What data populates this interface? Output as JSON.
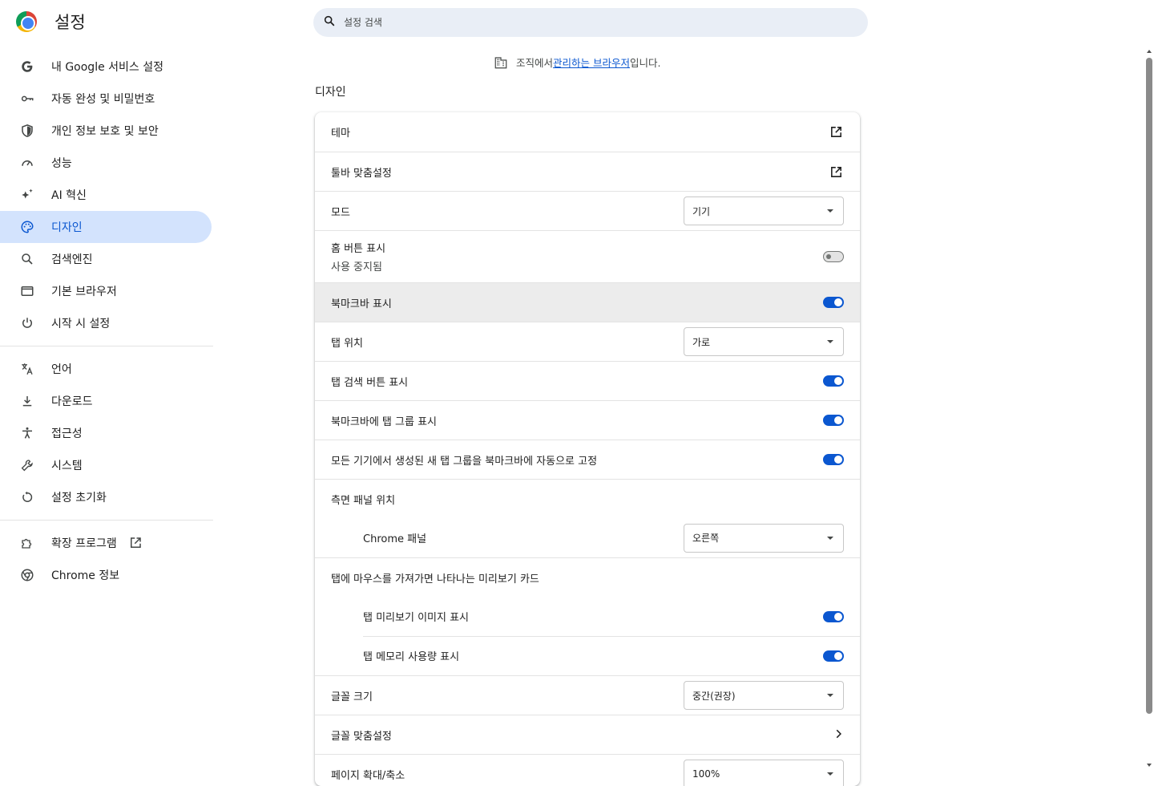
{
  "header": {
    "title": "설정",
    "search_placeholder": "설정 검색"
  },
  "sidebar": {
    "items": [
      {
        "label": "내 Google 서비스 설정",
        "icon": "google-g-icon"
      },
      {
        "label": "자동 완성 및 비밀번호",
        "icon": "key-icon"
      },
      {
        "label": "개인 정보 보호 및 보안",
        "icon": "shield-icon"
      },
      {
        "label": "성능",
        "icon": "speedometer-icon"
      },
      {
        "label": "AI 혁신",
        "icon": "sparkle-icon"
      },
      {
        "label": "디자인",
        "icon": "palette-icon",
        "active": true
      },
      {
        "label": "검색엔진",
        "icon": "search-icon"
      },
      {
        "label": "기본 브라우저",
        "icon": "browser-window-icon"
      },
      {
        "label": "시작 시 설정",
        "icon": "power-icon"
      }
    ],
    "items2": [
      {
        "label": "언어",
        "icon": "translate-icon"
      },
      {
        "label": "다운로드",
        "icon": "download-icon"
      },
      {
        "label": "접근성",
        "icon": "accessibility-icon"
      },
      {
        "label": "시스템",
        "icon": "wrench-icon"
      },
      {
        "label": "설정 초기화",
        "icon": "reset-icon"
      }
    ],
    "items3": [
      {
        "label": "확장 프로그램",
        "icon": "puzzle-icon"
      },
      {
        "label": "Chrome 정보",
        "icon": "chrome-icon"
      }
    ]
  },
  "managed": {
    "prefix": "조직에서 ",
    "link": "관리하는 브라우저",
    "suffix": "입니다."
  },
  "section": {
    "title": "디자인"
  },
  "settings": {
    "theme": "테마",
    "toolbar": "툴바 맞춤설정",
    "mode": "모드",
    "mode_value": "기기",
    "home_button": "홈 버튼 표시",
    "home_button_sub": "사용 중지됨",
    "bookmarks_bar": "북마크바 표시",
    "tab_position": "탭 위치",
    "tab_position_value": "가로",
    "tab_search": "탭 검색 버튼 표시",
    "tab_groups_bookmarks": "북마크바에 탭 그룹 표시",
    "auto_pin": "모든 기기에서 생성된 새 탭 그룹을 북마크바에 자동으로 고정",
    "side_panel": "측면 패널 위치",
    "chrome_panel": "Chrome 패널",
    "chrome_panel_value": "오른쪽",
    "hover_card": "탭에 마우스를 가져가면 나타나는 미리보기 카드",
    "tab_preview_image": "탭 미리보기 이미지 표시",
    "tab_memory": "탭 메모리 사용량 표시",
    "font_size": "글꼴 크기",
    "font_size_value": "중간(권장)",
    "font_custom": "글꼴 맞춤설정",
    "page_zoom": "페이지 확대/축소",
    "page_zoom_value": "100%"
  },
  "colors": {
    "accent": "#0b57d0",
    "active_bg": "#d3e3fd",
    "search_bg": "#e9eef6"
  }
}
